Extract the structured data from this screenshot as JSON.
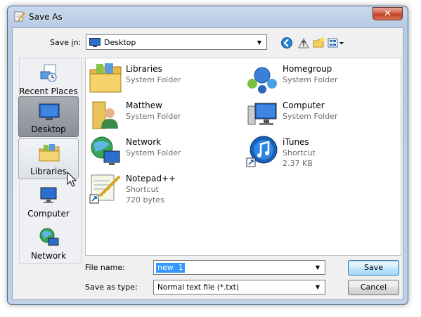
{
  "window": {
    "title": "Save As",
    "close_glyph": "✕"
  },
  "toolbar": {
    "save_in_label_prefix": "Save ",
    "save_in_label_accel": "i",
    "save_in_label_suffix": "n:",
    "location": "Desktop",
    "icons": [
      "back-icon",
      "up-folder-icon",
      "new-folder-icon",
      "views-menu-icon"
    ]
  },
  "places": [
    {
      "label": "Recent Places",
      "icon": "recent-places-icon",
      "state": "normal"
    },
    {
      "label": "Desktop",
      "icon": "desktop-icon",
      "state": "selected"
    },
    {
      "label": "Libraries",
      "icon": "libraries-icon",
      "state": "hover"
    },
    {
      "label": "Computer",
      "icon": "computer-icon",
      "state": "normal"
    },
    {
      "label": "Network",
      "icon": "network-icon",
      "state": "normal"
    }
  ],
  "files": [
    {
      "name": "Libraries",
      "type": "System Folder",
      "size": "",
      "icon": "libraries-icon"
    },
    {
      "name": "Homegroup",
      "type": "System Folder",
      "size": "",
      "icon": "homegroup-icon"
    },
    {
      "name": "Matthew",
      "type": "System Folder",
      "size": "",
      "icon": "user-folder-icon"
    },
    {
      "name": "Computer",
      "type": "System Folder",
      "size": "",
      "icon": "computer-icon"
    },
    {
      "name": "Network",
      "type": "System Folder",
      "size": "",
      "icon": "network-icon"
    },
    {
      "name": "iTunes",
      "type": "Shortcut",
      "size": "2.37 KB",
      "icon": "itunes-icon"
    },
    {
      "name": "Notepad++",
      "type": "Shortcut",
      "size": "720 bytes",
      "icon": "notepad-plus-plus-icon"
    }
  ],
  "form": {
    "filename_label": "File name:",
    "filename_value": "new  1",
    "savetype_label": "Save as type:",
    "savetype_value": "Normal text file (*.txt)"
  },
  "buttons": {
    "save": "Save",
    "cancel": "Cancel"
  },
  "colors": {
    "selection": "#3399ff",
    "title_bar": "#b6cbe4",
    "close_button": "#c13d1f"
  }
}
